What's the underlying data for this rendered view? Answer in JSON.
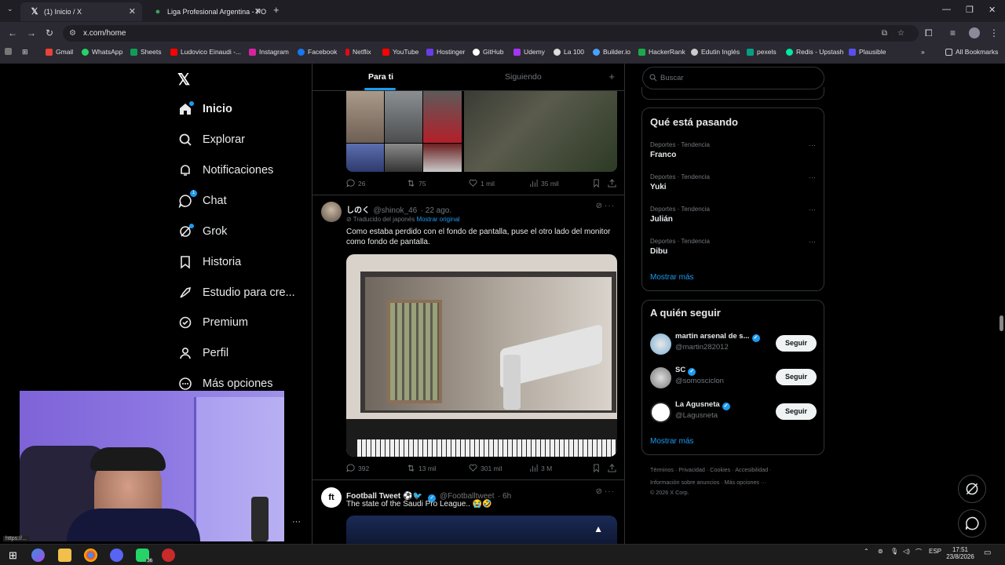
{
  "browser": {
    "tabs": [
      {
        "title": "(1) Inicio / X",
        "active": true
      },
      {
        "title": "Liga Profesional Argentina - PO",
        "active": false
      }
    ],
    "url": "x.com/home",
    "bookmarks": [
      "Gmail",
      "WhatsApp",
      "Sheets",
      "Ludovico Einaudi -...",
      "Instagram",
      "Facebook",
      "Netflix",
      "YouTube",
      "Hostinger",
      "GitHub",
      "Udemy",
      "La 100",
      "Builder.io",
      "HackerRank",
      "Edutin Inglés",
      "pexels",
      "Redis - Upstash",
      "Plausible"
    ],
    "all_bookmarks": "All Bookmarks",
    "status_url": "https://..."
  },
  "nav": {
    "items": [
      {
        "label": "Inicio",
        "icon": "home-icon"
      },
      {
        "label": "Explorar",
        "icon": "search-icon"
      },
      {
        "label": "Notificaciones",
        "icon": "bell-icon"
      },
      {
        "label": "Chat",
        "icon": "chat-icon"
      },
      {
        "label": "Grok",
        "icon": "grok-icon"
      },
      {
        "label": "Historia",
        "icon": "bookmark-icon"
      },
      {
        "label": "Estudio para cre...",
        "icon": "rocket-icon"
      },
      {
        "label": "Premium",
        "icon": "premium-icon"
      },
      {
        "label": "Perfil",
        "icon": "person-icon"
      },
      {
        "label": "Más opciones",
        "icon": "more-icon"
      }
    ],
    "chat_badge": "1"
  },
  "feed": {
    "tabs": [
      "Para ti",
      "Siguiendo"
    ],
    "post1": {
      "replies": "26",
      "reposts": "75",
      "likes": "1 mil",
      "views": "35 mil"
    },
    "post2": {
      "name": "しのく",
      "handle": "@shinok_46",
      "date": "· 22 ago.",
      "translated": "Traducido del japonés",
      "show_original": "Mostrar original",
      "text": "Como estaba perdido con el fondo de pantalla, puse el otro lado del monitor como fondo de pantalla.",
      "replies": "392",
      "reposts": "13 mil",
      "likes": "301 mil",
      "views": "3 M"
    },
    "post3": {
      "name": "Football Tweet ⚽🐦",
      "handle": "@Footballtweet",
      "date": "· 6h",
      "text": "The state of the Saudi Pro League.. 😭🤣"
    }
  },
  "right": {
    "search_placeholder": "Buscar",
    "trending_title": "Qué está pasando",
    "trends": [
      {
        "meta": "Deportes · Tendencia",
        "name": "Franco"
      },
      {
        "meta": "Deportes · Tendencia",
        "name": "Yuki"
      },
      {
        "meta": "Deportes · Tendencia",
        "name": "Julián"
      },
      {
        "meta": "Deportes · Tendencia",
        "name": "Dibu"
      }
    ],
    "show_more": "Mostrar más",
    "who_title": "A quién seguir",
    "who": [
      {
        "name": "martin arsenal de s...",
        "handle": "@martin282012",
        "button": "Seguir"
      },
      {
        "name": "SC",
        "handle": "@somosciclon",
        "button": "Seguir"
      },
      {
        "name": "La Agusneta",
        "handle": "@Lagusneta",
        "button": "Seguir"
      }
    ],
    "who_more": "Mostrar más",
    "footer1": "Términos · Privacidad · Cookies · Accesibilidad ·",
    "footer2": "Información sobre anuncios · Más opciones ···",
    "footer3": "© 2026 X Corp."
  },
  "taskbar": {
    "lang": "ESP",
    "time": "17:51",
    "date": "23/8/2026",
    "discord_badge": "36"
  },
  "colors": {
    "accent": "#1d9bf0",
    "bg": "#000000",
    "border": "#2f3336",
    "muted": "#71767b"
  }
}
